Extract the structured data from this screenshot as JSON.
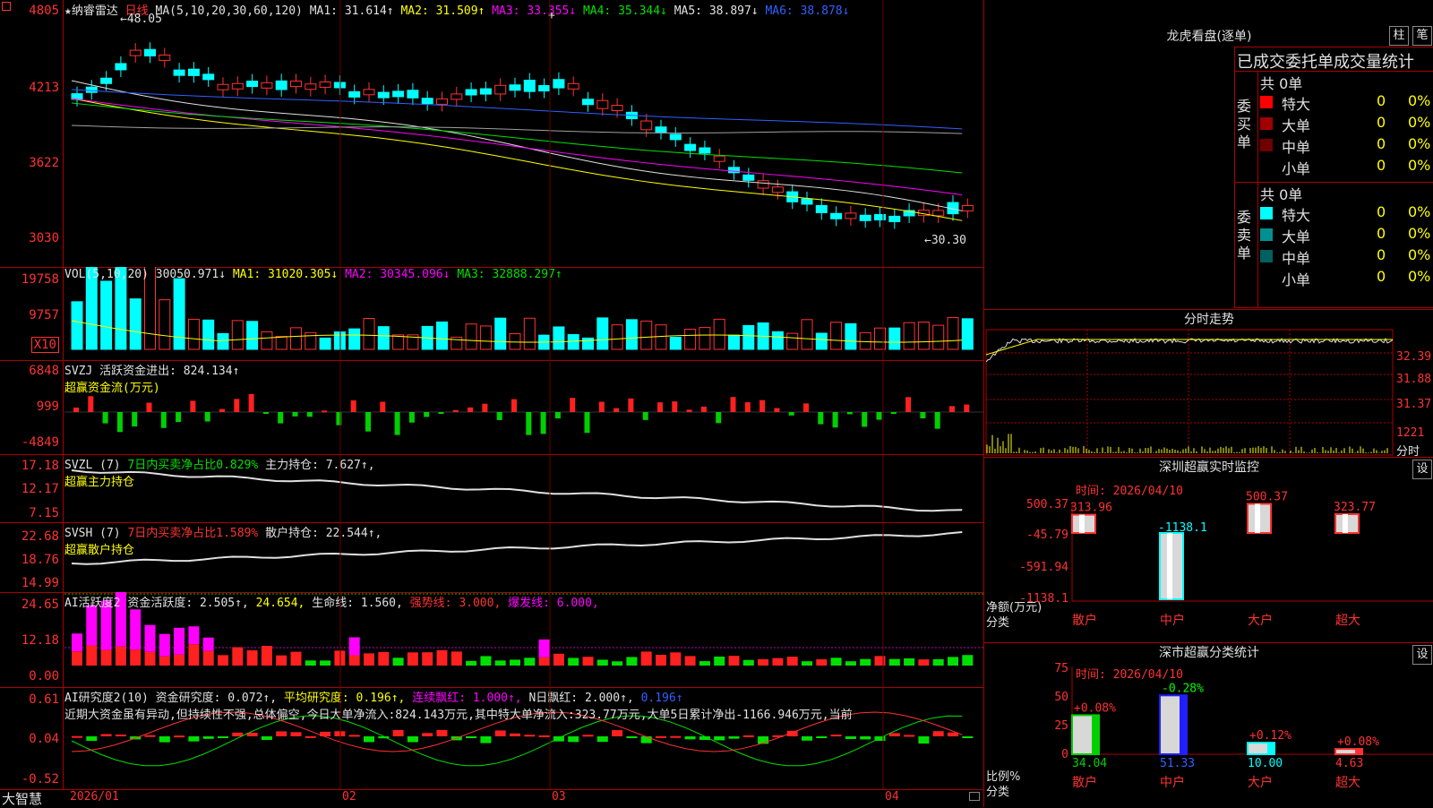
{
  "price_pane": {
    "legend": [
      {
        "text": "★纳睿雷达",
        "cls": "w"
      },
      {
        "text": "日线",
        "cls": "r"
      },
      {
        "text": "MA(5,10,20,30,60,120)",
        "cls": "w"
      },
      {
        "text": "MA1: 31.614↑",
        "cls": "w"
      },
      {
        "text": "MA2: 31.509↑",
        "cls": "y"
      },
      {
        "text": "MA3: 33.355↓",
        "cls": "m"
      },
      {
        "text": "MA4: 35.344↓",
        "cls": "g"
      },
      {
        "text": "MA5: 38.897↓",
        "cls": "w"
      },
      {
        "text": "MA6: 38.878↓",
        "cls": "b"
      }
    ],
    "yaxis": [
      "4805",
      "4213",
      "3622",
      "3030"
    ],
    "high_mark": "48.05",
    "low_mark": "30.30",
    "crosshair": "+"
  },
  "vol_pane": {
    "legend": [
      {
        "text": "VOL(5,10,20)",
        "cls": "w"
      },
      {
        "text": "30050.971↓",
        "cls": "w"
      },
      {
        "text": "MA1: 31020.305↓",
        "cls": "y"
      },
      {
        "text": "MA2: 30345.096↓",
        "cls": "m"
      },
      {
        "text": "MA3: 32888.297↑",
        "cls": "g"
      }
    ],
    "yaxis": [
      "19758",
      "9757"
    ],
    "unit": "X10"
  },
  "svzj_pane": {
    "legend": [
      {
        "text": "SVZJ",
        "cls": "w"
      },
      {
        "text": "活跃资金进出: 824.134↑",
        "cls": "w"
      }
    ],
    "sub": "超赢资金流(万元)",
    "yaxis": [
      "6848",
      "999",
      "-4849"
    ]
  },
  "svzl_pane": {
    "legend": [
      {
        "text": "SVZL (7)",
        "cls": "w"
      },
      {
        "text": "7日内买卖净占比0.829%",
        "cls": "g"
      },
      {
        "text": "主力持仓: 7.627↑,",
        "cls": "w"
      }
    ],
    "sub": "超赢主力持仓",
    "yaxis": [
      "17.18",
      "12.17",
      "7.15"
    ]
  },
  "svsh_pane": {
    "legend": [
      {
        "text": "SVSH (7)",
        "cls": "w"
      },
      {
        "text": "7日内买卖净占比1.589%",
        "cls": "r"
      },
      {
        "text": "散户持仓: 22.544↑,",
        "cls": "w"
      }
    ],
    "sub": "超赢散户持仓",
    "yaxis": [
      "22.68",
      "18.76",
      "14.99"
    ]
  },
  "ai1_pane": {
    "legend": [
      {
        "text": "AI活跃度2",
        "cls": "w"
      },
      {
        "text": "资金活跃度: 2.505↑,",
        "cls": "w"
      },
      {
        "text": "24.654,",
        "cls": "y"
      },
      {
        "text": "生命线: 1.560,",
        "cls": "w"
      },
      {
        "text": "强势线: 3.000,",
        "cls": "r"
      },
      {
        "text": "爆发线: 6.000,",
        "cls": "m"
      }
    ],
    "yaxis": [
      "24.65",
      "12.18",
      "0.00"
    ]
  },
  "ai2_pane": {
    "legend": [
      {
        "text": "AI研究度2(10)",
        "cls": "w"
      },
      {
        "text": "资金研究度: 0.072↑,",
        "cls": "w"
      },
      {
        "text": "平均研究度: 0.196↑,",
        "cls": "y"
      },
      {
        "text": "连续飘红: 1.000↑,",
        "cls": "m"
      },
      {
        "text": "N日飘红: 2.000↑,",
        "cls": "w"
      },
      {
        "text": "0.196↑",
        "cls": "b"
      }
    ],
    "comment": "近期大资金虽有异动,但持续性不强,总体偏空,今日大单净流入:824.143万元,其中特大单净流入:323.77万元,大单5日累计净出-1166.946万元,当前",
    "yaxis": [
      "0.61",
      "0.04",
      "-0.52"
    ]
  },
  "date_axis": {
    "labels": [
      "2026/01",
      "02",
      "03",
      "04"
    ],
    "brand": "大智慧"
  },
  "dragon_tiger": {
    "title": "龙虎看盘(逐单)",
    "btn1": "柱",
    "btn2": "笔",
    "section_title": "已成交委托单成交量统计",
    "buy_side": "委买单",
    "sell_side": "委卖单",
    "buy_total": "共 0单",
    "sell_total": "共 0单",
    "rows": [
      "特大",
      "大单",
      "中单",
      "小单"
    ],
    "zero": "0",
    "pct": "0%",
    "buy_colors": [
      "#ff0000",
      "#a00000",
      "#700000",
      "#000000"
    ],
    "sell_colors": [
      "#00ffff",
      "#009090",
      "#006060",
      "#000000"
    ]
  },
  "intraday": {
    "title": "分时走势",
    "prices": [
      "32.39",
      "31.88",
      "31.37"
    ],
    "vol": "1221",
    "unit": "分时"
  },
  "monitor": {
    "title": "深圳超赢实时监控",
    "btn": "设",
    "time": "时间: 2026/04/10",
    "yaxis": [
      "500.37",
      "-45.79",
      "-591.94",
      "-1138.1"
    ],
    "ylabel": "净额(万元)",
    "xlabel": "分类",
    "categories": [
      "散户",
      "中户",
      "大户",
      "超大"
    ],
    "values": [
      "313.96",
      "-1138.1",
      "500.37",
      "323.77"
    ]
  },
  "stats": {
    "title": "深市超赢分类统计",
    "btn": "设",
    "time": "时间: 2026/04/10",
    "yaxis": [
      "75",
      "50",
      "25",
      "0"
    ],
    "ylabel": "比例%",
    "xlabel": "分类",
    "categories": [
      "散户",
      "中户",
      "大户",
      "超大"
    ],
    "values": [
      "34.04",
      "51.33",
      "10.00",
      "4.63"
    ],
    "changes": [
      "+0.08%",
      "-0.28%",
      "+0.12%",
      "+0.08%"
    ]
  }
}
